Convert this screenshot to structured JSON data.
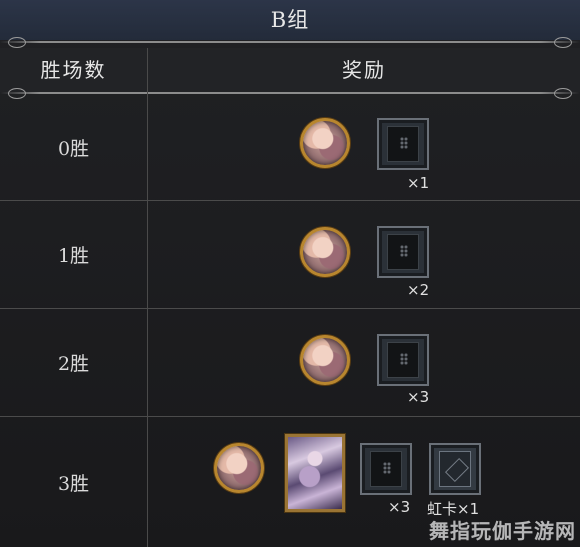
{
  "title": "B组",
  "header": {
    "col1": "胜场数",
    "col2": "奖励"
  },
  "rows": [
    {
      "label": "0胜",
      "card_qty": "×1"
    },
    {
      "label": "1胜",
      "card_qty": "×2"
    },
    {
      "label": "2胜",
      "card_qty": "×3"
    },
    {
      "label": "3胜",
      "card_qty": "×3",
      "rainbow_label": "虹卡×1"
    }
  ],
  "watermark": "舞指玩伽手游网",
  "icons": {
    "avatar": "character-portrait-icon",
    "card_pack": "card-back-icon",
    "art_card": "character-card-art",
    "rainbow_card": "rainbow-card-icon"
  },
  "colors": {
    "title_bg": "#2c3548",
    "gold_border": "#b8862e",
    "bg": "#1b1c1f"
  }
}
